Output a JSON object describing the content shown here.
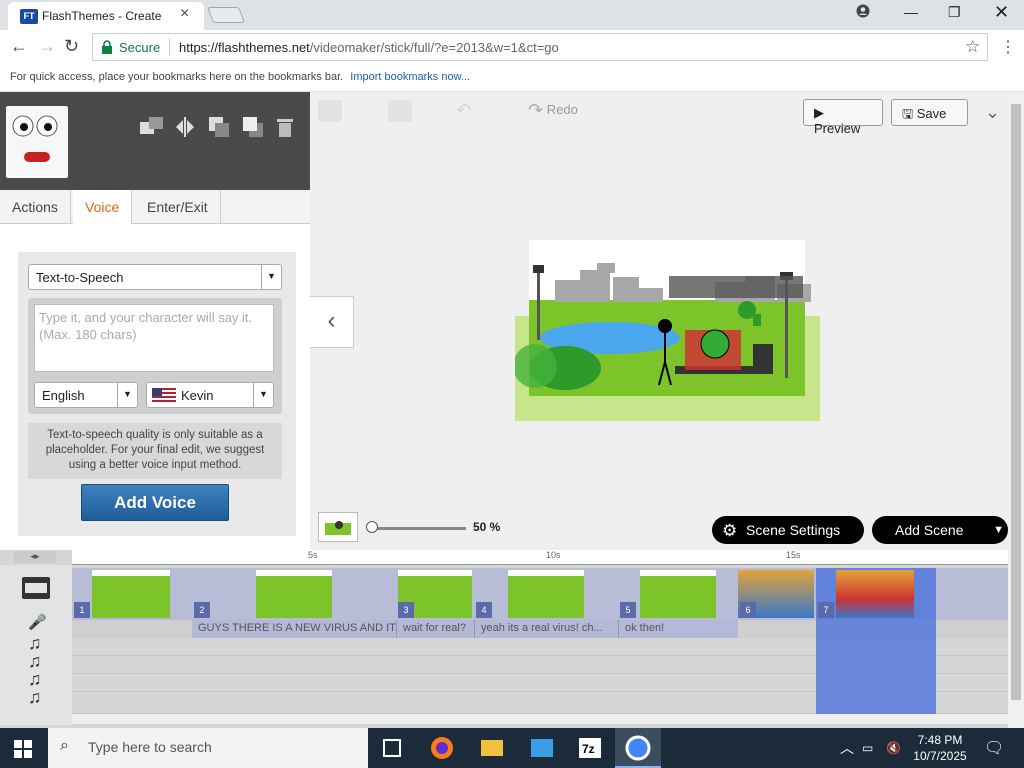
{
  "browser": {
    "tab_title": "FlashThemes - Create",
    "favicon_text": "FT",
    "secure_label": "Secure",
    "url_host": "https://flashthemes.net",
    "url_path": "/videomaker/stick/full/?e=2013&w=1&ct=go",
    "bookmarks_hint": "For quick access, place your bookmarks here on the bookmarks bar.",
    "import_link": "Import bookmarks now..."
  },
  "toolbar": {
    "redo_label": "Redo",
    "preview_label": "Preview",
    "save_label": "Save"
  },
  "panel": {
    "tabs": [
      "Actions",
      "Voice",
      "Enter/Exit"
    ],
    "active_tab": "Voice",
    "voice_mode": "Text-to-Speech",
    "textarea_placeholder": "Type it, and your character will say it.  (Max.  180 chars)",
    "language": "English",
    "voice_name": "Kevin",
    "note": "Text-to-speech quality is only suitable as a placeholder. For your final edit, we suggest using a better voice input method.",
    "add_voice_label": "Add Voice"
  },
  "stage": {
    "zoom": "50 %",
    "scene_settings_label": "Scene Settings",
    "add_scene_label": "Add Scene"
  },
  "timeline": {
    "ruler_labels": [
      "5s",
      "10s",
      "15s"
    ],
    "scenes": [
      "1",
      "2",
      "3",
      "4",
      "5",
      "6",
      "7"
    ],
    "voice_clips": [
      "GUYS THERE IS A NEW VIRUS AND IT...",
      "wait for real?",
      "yeah its a real virus! ch...",
      "ok then!"
    ]
  },
  "taskbar": {
    "search_placeholder": "Type here to search",
    "time": "7:48 PM",
    "date": "10/7/2025"
  },
  "colors": {
    "active_tab": "#d86a17",
    "add_voice": "#2a6aa9",
    "selection": "#4a6edc"
  }
}
